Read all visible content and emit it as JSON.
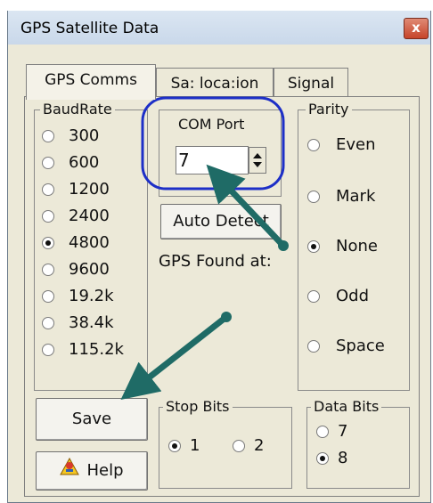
{
  "window": {
    "title": "GPS Satellite Data",
    "close_symbol": "x"
  },
  "tabs": [
    {
      "label": "GPS Comms",
      "active": true
    },
    {
      "label": "Sa: loca:ion",
      "active": false
    },
    {
      "label": "Signal",
      "active": false
    }
  ],
  "baudrate": {
    "legend": "BaudRate",
    "selected": "4800",
    "options": [
      "300",
      "600",
      "1200",
      "2400",
      "4800",
      "9600",
      "19.2k",
      "38.4k",
      "115.2k"
    ]
  },
  "com_port": {
    "legend": "COM Port",
    "value": "7"
  },
  "auto_detect_label": "Auto Detect",
  "gps_found_label": "GPS Found at:",
  "parity": {
    "legend": "Parity",
    "selected": "None",
    "options": [
      "Even",
      "Mark",
      "None",
      "Odd",
      "Space"
    ]
  },
  "save_label": "Save",
  "help_label": "Help",
  "stop_bits": {
    "legend": "Stop Bits",
    "selected": "1",
    "options": [
      "1",
      "2"
    ]
  },
  "data_bits": {
    "legend": "Data Bits",
    "selected": "8",
    "options": [
      "7",
      "8"
    ]
  },
  "colors": {
    "annotation_circle": "#1d2fc7",
    "annotation_arrow": "#1f6b66"
  }
}
